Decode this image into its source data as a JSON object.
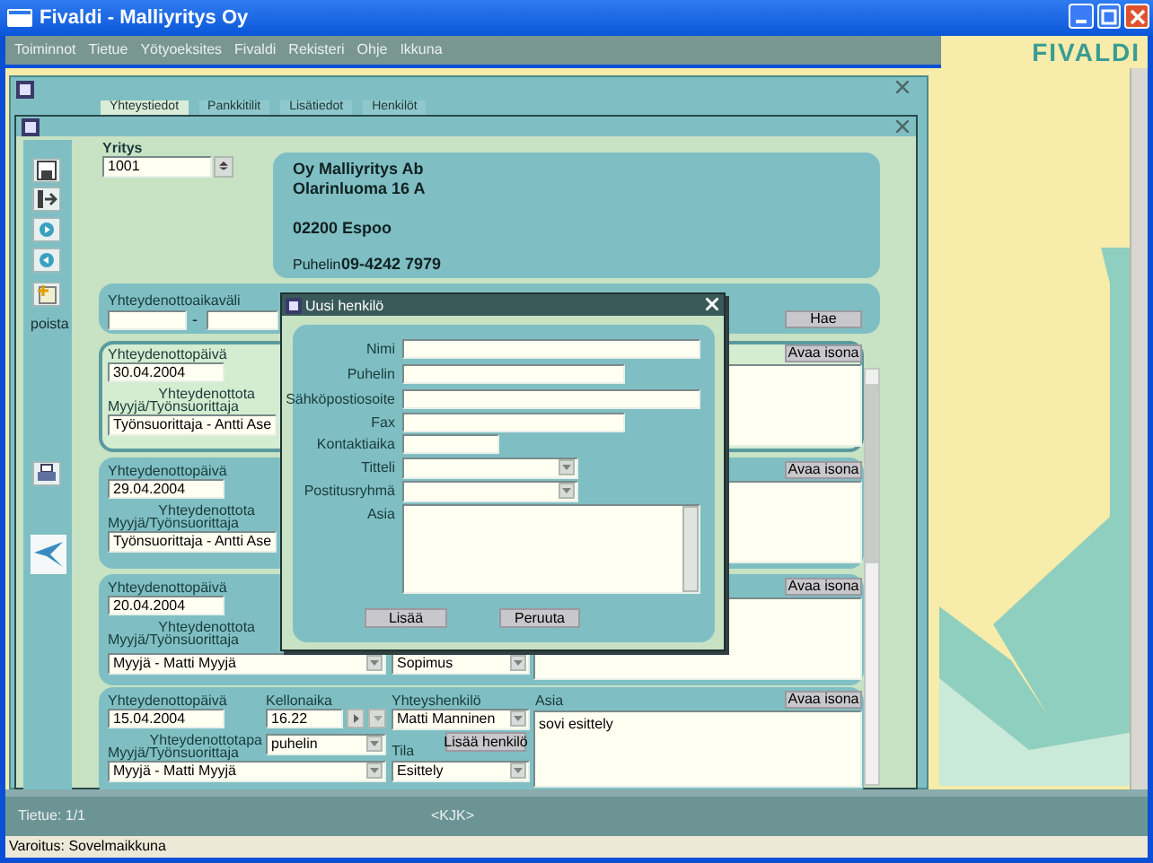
{
  "window": {
    "title": "Fivaldi - Malliyritys Oy"
  },
  "menu": [
    {
      "label": "Toiminnot"
    },
    {
      "label": "Tietue"
    },
    {
      "label": "Yötyoeksites"
    },
    {
      "label": "Fivaldi"
    },
    {
      "label": "Rekisteri"
    },
    {
      "label": "Ohje"
    },
    {
      "label": "Ikkuna"
    }
  ],
  "logo": "FIVALDI",
  "tabs": [
    {
      "label": "Yhteystiedot",
      "selected": true
    },
    {
      "label": "Pankkitilit",
      "selected": false
    },
    {
      "label": "Lisätiedot",
      "selected": false
    },
    {
      "label": "Henkilöt",
      "selected": false
    }
  ],
  "company": {
    "label": "Yritys",
    "value": "1001",
    "name": "Oy Malliyritys Ab",
    "address": "Olarinluoma 16 A",
    "postal": "02200 Espoo",
    "phone_label": "Puhelin",
    "phone": "09-4242 7979"
  },
  "toolbar": {
    "delete_label": "poista"
  },
  "range": {
    "label": "Yhteydenottoaikaväli",
    "separator": "-",
    "search_button": "Hae"
  },
  "records": [
    {
      "kind": "covered",
      "selected": true,
      "date_label": "Yhteydenottopäivä",
      "date": "30.04.2004",
      "method_label": "Yhteydenottota",
      "person_label": "Myyjä/Työnsuorittaja",
      "person": "Työnsuorittaja - Antti Ase",
      "open_button": "Avaa isona"
    },
    {
      "kind": "covered",
      "selected": false,
      "date_label": "Yhteydenottopäivä",
      "date": "29.04.2004",
      "method_label": "Yhteydenottota",
      "person_label": "Myyjä/Työnsuorittaja",
      "person": "Työnsuorittaja - Antti Ase",
      "open_button": "Avaa isona"
    },
    {
      "kind": "covered",
      "selected": false,
      "date_label": "Yhteydenottopäivä",
      "date": "20.04.2004",
      "method_label": "Yhteydenottota",
      "person_label": "Myyjä/Työnsuorittaja",
      "person": "Myyjä - Matti Myyjä",
      "status": "Sopimus",
      "open_button": "Avaa isona"
    },
    {
      "kind": "full",
      "selected": false,
      "date_label": "Yhteydenottopäivä",
      "date": "15.04.2004",
      "time_label": "Kellonaika",
      "time": "16.22",
      "contact_label": "Yhteyshenkilö",
      "contact": "Matti Manninen",
      "subject_label": "Asia",
      "subject": "sovi esittely",
      "method_label": "Yhteydenottotapa",
      "method": "puhelin",
      "add_person_button": "Lisää henkilö",
      "person_label": "Myyjä/Työnsuorittaja",
      "person": "Myyjä - Matti Myyjä",
      "status_label": "Tila",
      "status": "Esittely",
      "open_button": "Avaa isona"
    }
  ],
  "dialog": {
    "title": "Uusi henkilö",
    "fields": [
      {
        "label": "Nimi",
        "kind": "long"
      },
      {
        "label": "Puhelin",
        "kind": "medium"
      },
      {
        "label": "Sähköpostiosoite",
        "kind": "long"
      },
      {
        "label": "Fax",
        "kind": "medium"
      },
      {
        "label": "Kontaktiaika",
        "kind": "short"
      },
      {
        "label": "Titteli",
        "kind": "dropdown"
      },
      {
        "label": "Postitusryhmä",
        "kind": "dropdown"
      },
      {
        "label": "Asia",
        "kind": "textarea"
      }
    ],
    "buttons": [
      {
        "label": "Lisää"
      },
      {
        "label": "Peruuta"
      }
    ]
  },
  "status_bar": {
    "record": "Tietue: 1/1",
    "mode": "<KJK>"
  },
  "message": "Varoitus: Sovelmaikkuna"
}
